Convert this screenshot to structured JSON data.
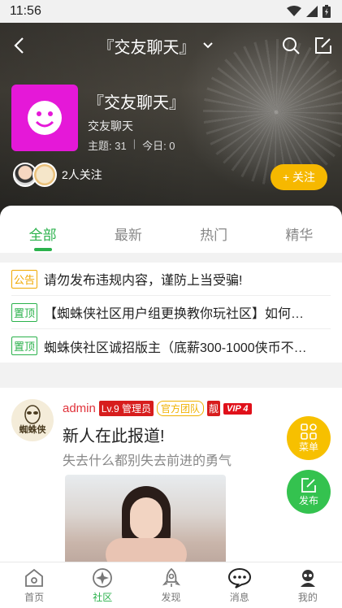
{
  "status_bar": {
    "time": "11:56"
  },
  "header": {
    "title": "『交友聊天』"
  },
  "forum": {
    "name": "『交友聊天』",
    "subtitle": "交友聊天",
    "topics": "主题: 31",
    "today": "今日: 0",
    "followers_text": "2人关注",
    "follow_label": "+ 关注"
  },
  "tabs": [
    {
      "label": "全部",
      "active": true
    },
    {
      "label": "最新",
      "active": false
    },
    {
      "label": "热门",
      "active": false
    },
    {
      "label": "精华",
      "active": false
    }
  ],
  "notices": [
    {
      "tag": "公告",
      "text": "请勿发布违规内容，谨防上当受骗!"
    },
    {
      "tag": "置顶",
      "text": "【蜘蛛侠社区用户组更换教你玩社区】如何…"
    },
    {
      "tag": "置顶",
      "text": "蜘蛛侠社区诚招版主（底薪300-1000侠币不…"
    }
  ],
  "post": {
    "avatar_text": "蜘蛛侠",
    "username": "admin",
    "level": "Lv.9 管理员",
    "team": "官方团队",
    "liang": "靓",
    "vip": "VIP 4",
    "title": "新人在此报道!",
    "desc": "失去什么都别失去前进的勇气"
  },
  "fabs": {
    "menu_label": "菜单",
    "post_label": "发布"
  },
  "bottom_nav": [
    {
      "label": "首页",
      "icon": "home-icon",
      "active": false
    },
    {
      "label": "社区",
      "icon": "community-icon",
      "active": true
    },
    {
      "label": "发现",
      "icon": "rocket-icon",
      "active": false
    },
    {
      "label": "消息",
      "icon": "message-icon",
      "active": false
    },
    {
      "label": "我的",
      "icon": "profile-icon",
      "active": false
    }
  ],
  "colors": {
    "accent": "#2bb24c",
    "follow": "#f6b800",
    "forum_logo": "#e518d8",
    "admin_red": "#e0323a"
  }
}
